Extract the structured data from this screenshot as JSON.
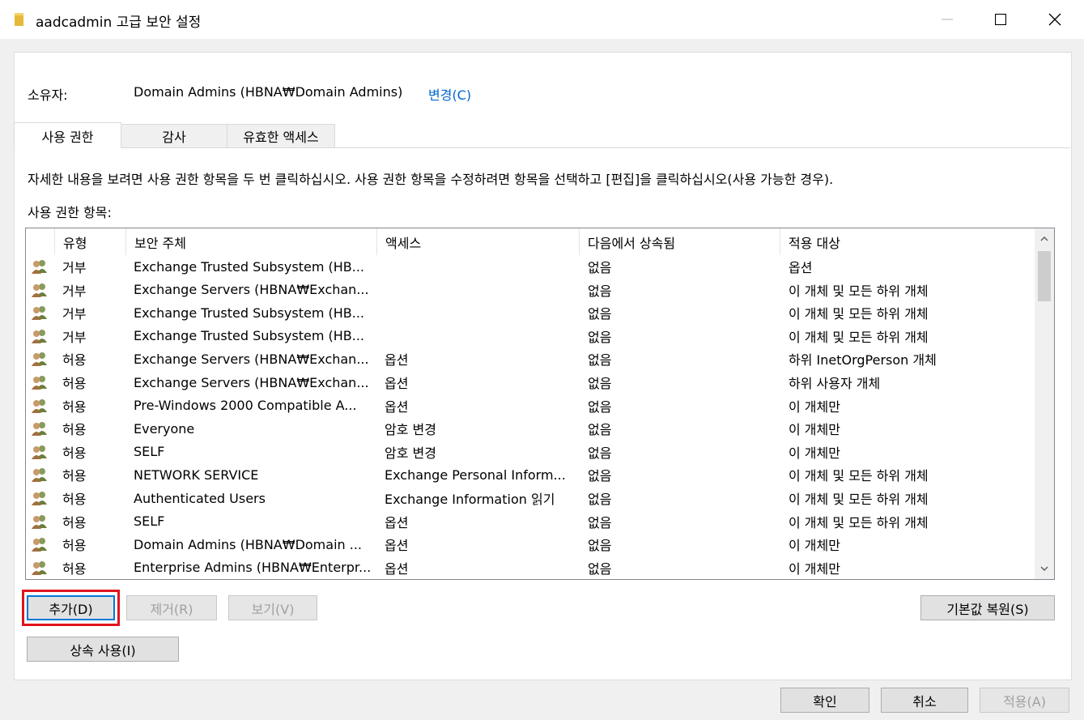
{
  "window": {
    "title": "aadcadmin 고급 보안 설정"
  },
  "owner": {
    "label": "소유자:",
    "value": "Domain Admins (HBNA₩Domain Admins)",
    "change_link": "변경(C)"
  },
  "tabs": [
    {
      "label": "사용 권한",
      "active": true
    },
    {
      "label": "감사",
      "active": false
    },
    {
      "label": "유효한 액세스",
      "active": false
    }
  ],
  "description": "자세한 내용을 보려면 사용 권한 항목을 두 번 클릭하십시오. 사용 권한 항목을 수정하려면 항목을 선택하고 [편집]을 클릭하십시오(사용 가능한 경우).",
  "entries_label": "사용 권한 항목:",
  "table": {
    "columns": [
      "유형",
      "보안 주체",
      "액세스",
      "다음에서 상속됨",
      "적용 대상"
    ],
    "rows": [
      {
        "type": "거부",
        "principal": "Exchange Trusted Subsystem (HB...",
        "access": "",
        "inherited": "없음",
        "applies": "옵션"
      },
      {
        "type": "거부",
        "principal": "Exchange Servers (HBNA₩Exchan...",
        "access": "",
        "inherited": "없음",
        "applies": "이 개체 및 모든 하위 개체"
      },
      {
        "type": "거부",
        "principal": "Exchange Trusted Subsystem (HB...",
        "access": "",
        "inherited": "없음",
        "applies": "이 개체 및 모든 하위 개체"
      },
      {
        "type": "거부",
        "principal": "Exchange Trusted Subsystem (HB...",
        "access": "",
        "inherited": "없음",
        "applies": "이 개체 및 모든 하위 개체"
      },
      {
        "type": "허용",
        "principal": "Exchange Servers (HBNA₩Exchan...",
        "access": "옵션",
        "inherited": "없음",
        "applies": "하위 InetOrgPerson 개체"
      },
      {
        "type": "허용",
        "principal": "Exchange Servers (HBNA₩Exchan...",
        "access": "옵션",
        "inherited": "없음",
        "applies": "하위 사용자 개체"
      },
      {
        "type": "허용",
        "principal": "Pre-Windows 2000 Compatible A...",
        "access": "옵션",
        "inherited": "없음",
        "applies": "이 개체만"
      },
      {
        "type": "허용",
        "principal": "Everyone",
        "access": "암호 변경",
        "inherited": "없음",
        "applies": "이 개체만"
      },
      {
        "type": "허용",
        "principal": "SELF",
        "access": "암호 변경",
        "inherited": "없음",
        "applies": "이 개체만"
      },
      {
        "type": "허용",
        "principal": "NETWORK SERVICE",
        "access": "Exchange Personal Inform...",
        "inherited": "없음",
        "applies": "이 개체 및 모든 하위 개체"
      },
      {
        "type": "허용",
        "principal": "Authenticated Users",
        "access": "Exchange Information 읽기",
        "inherited": "없음",
        "applies": "이 개체 및 모든 하위 개체"
      },
      {
        "type": "허용",
        "principal": "SELF",
        "access": "옵션",
        "inherited": "없음",
        "applies": "이 개체 및 모든 하위 개체"
      },
      {
        "type": "허용",
        "principal": "Domain Admins (HBNA₩Domain ...",
        "access": "옵션",
        "inherited": "없음",
        "applies": "이 개체만"
      },
      {
        "type": "허용",
        "principal": "Enterprise Admins (HBNA₩Enterpr...",
        "access": "옵션",
        "inherited": "없음",
        "applies": "이 개체만"
      }
    ]
  },
  "buttons": {
    "add": "추가(D)",
    "remove": "제거(R)",
    "view": "보기(V)",
    "restore_defaults": "기본값 복원(S)",
    "enable_inheritance": "상속 사용(I)",
    "ok": "확인",
    "cancel": "취소",
    "apply": "적용(A)"
  },
  "icons": {
    "title": "folder-icon",
    "row": "users-icon"
  },
  "colors": {
    "link": "#0066cc",
    "highlight": "#e0141e",
    "focus": "#0078d7"
  }
}
